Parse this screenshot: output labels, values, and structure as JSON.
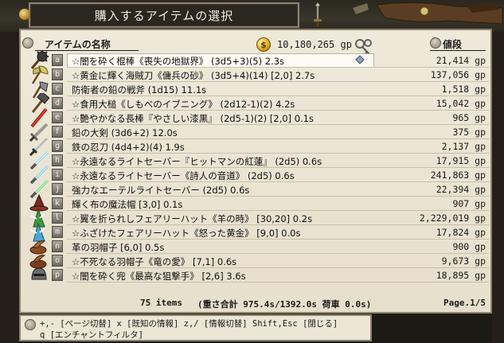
{
  "window": {
    "title": "購入するアイテムの選択"
  },
  "header": {
    "name_col": "アイテムの名称",
    "gold": "10,180,265 gp",
    "price_col": "値段",
    "coin_glyph": "$"
  },
  "items": [
    {
      "key": "a",
      "name": "☆闇を砕く棍棒《喪失の地獄界》 (3d5+3)(5) 2.3s",
      "price": "21,414 gp",
      "icon": "spiked-mace-icon",
      "selected": true
    },
    {
      "key": "b",
      "name": "☆黄金に輝く海賊刀《傭兵の砂》 (3d5+4)(14) [2,0] 2.7s",
      "price": "137,056 gp",
      "icon": "battle-axe-icon"
    },
    {
      "key": "c",
      "name": "防衛者の鉛の戦斧 (1d15) 11.1s",
      "price": "1,518 gp",
      "icon": "war-axe-icon"
    },
    {
      "key": "d",
      "name": "☆食用大槌《しもべのイブニング》 (2d12-1)(2) 4.2s",
      "price": "15,042 gp",
      "icon": "mallet-icon"
    },
    {
      "key": "e",
      "name": "☆艶やかなる長棒『やさしい漆黒』 (2d5-1)(2) [2,0] 0.1s",
      "price": "965 gp",
      "icon": "staff-icon"
    },
    {
      "key": "f",
      "name": "鉛の大剣 (3d6+2) 12.0s",
      "price": "375 gp",
      "icon": "greatsword-icon"
    },
    {
      "key": "g",
      "name": "鉄の忍刀 (4d4+2)(4) 1.9s",
      "price": "2,137 gp",
      "icon": "ninja-sword-icon"
    },
    {
      "key": "h",
      "name": "☆永遠なるライトセーバー『ヒットマンの紅蓮』 (2d5) 0.6s",
      "price": "17,915 gp",
      "icon": "lightsaber-icon"
    },
    {
      "key": "i",
      "name": "☆永遠なるライトセーバー《詩人の音道》 (2d5) 0.6s",
      "price": "241,863 gp",
      "icon": "lightsaber-icon"
    },
    {
      "key": "j",
      "name": "強力なエーテルライトセーバー (2d5) 0.6s",
      "price": "22,394 gp",
      "icon": "lightsaber-icon"
    },
    {
      "key": "k",
      "name": "輝く布の魔法帽 [3,0] 0.1s",
      "price": "907 gp",
      "icon": "wizard-hat-icon"
    },
    {
      "key": "l",
      "name": "☆翼を折られしフェアリーハット《羊の時》 [30,20] 0.2s",
      "price": "2,229,019 gp",
      "icon": "fairy-hat-icon"
    },
    {
      "key": "m",
      "name": "☆ふざけたフェアリーハット《怒った黄金》 [9,0] 0.0s",
      "price": "17,824 gp",
      "icon": "fairy-hat-icon"
    },
    {
      "key": "n",
      "name": "革の羽帽子 [6,0] 0.5s",
      "price": "900 gp",
      "icon": "feather-hat-icon"
    },
    {
      "key": "o",
      "name": "☆不死なる羽帽子《竜の愛》 [7,1] 0.6s",
      "price": "9,673 gp",
      "icon": "feather-hat-icon"
    },
    {
      "key": "p",
      "name": "☆闇を砕く兜《最高な狙撃手》 [2,6] 3.6s",
      "price": "18,895 gp",
      "icon": "helmet-icon"
    }
  ],
  "summary": {
    "count": "75 items",
    "weight": "(重さ合計 975.4s/1392.0s  荷車 0.0s)",
    "page": "Page.1/5"
  },
  "help": {
    "line1": "+,- [ページ切替]  x [既知の情報]  z,/ [情報切替]  Shift,Esc [閉じる]",
    "line2": "q [エンチャントフィルタ]"
  },
  "colors": {
    "panel_bg": "#efe9da",
    "frame_dark": "#241f18",
    "selection_bg": "#fdfbf4",
    "key_badge": "#8c897f"
  }
}
